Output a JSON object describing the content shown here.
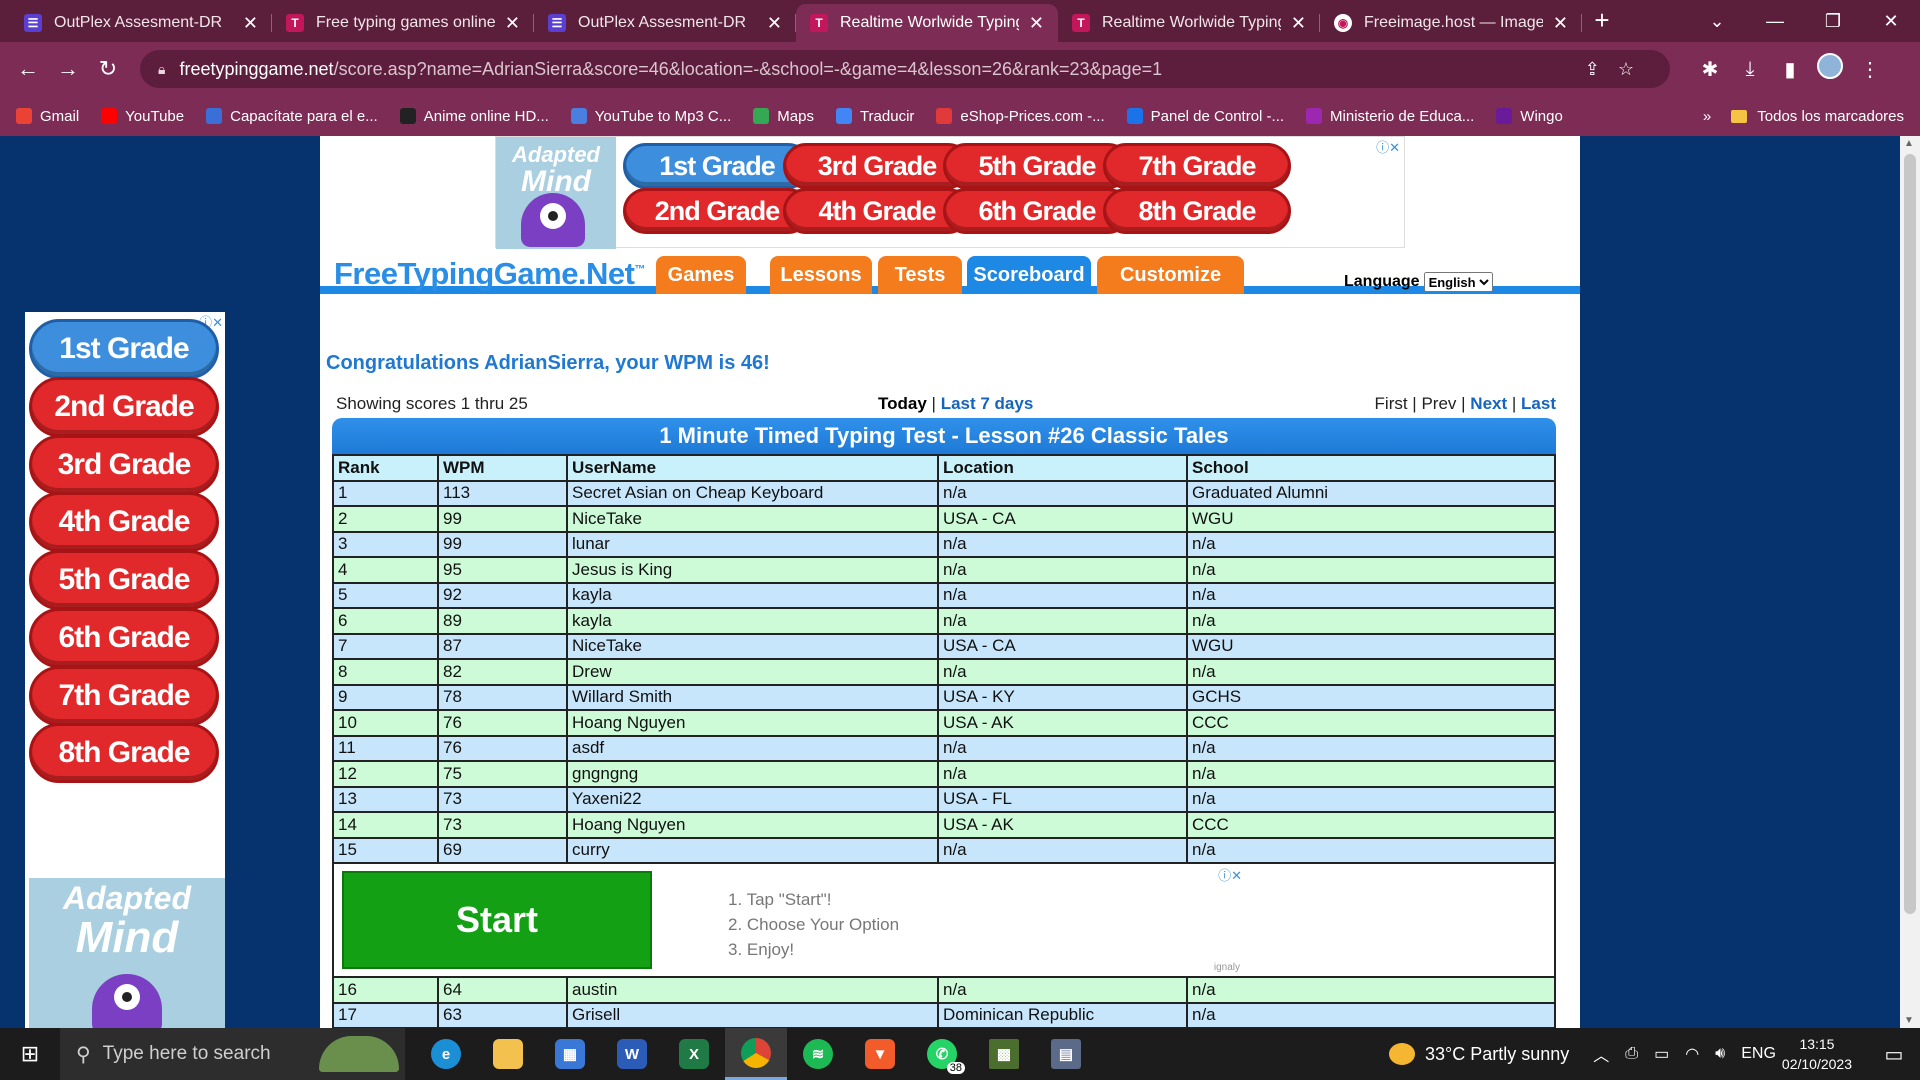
{
  "browser": {
    "tabs": [
      {
        "title": "OutPlex Assesment-DR",
        "icon": "purple"
      },
      {
        "title": "Free typing games online,",
        "icon": "pink"
      },
      {
        "title": "OutPlex Assesment-DR",
        "icon": "purple"
      },
      {
        "title": "Realtime Worlwide Typing",
        "icon": "pink",
        "active": true
      },
      {
        "title": "Realtime Worlwide Typing",
        "icon": "pink"
      },
      {
        "title": "Freeimage.host — Image H",
        "icon": "white"
      }
    ],
    "url_host": "freetypinggame.net",
    "url_rest": "/score.asp?name=AdrianSierra&score=46&location=-&school=-&game=4&lesson=26&rank=23&page=1",
    "bookmarks": [
      {
        "label": "Gmail",
        "color": "#ea4335"
      },
      {
        "label": "YouTube",
        "color": "#ff0000"
      },
      {
        "label": "Capacítate para el e...",
        "color": "#3a6fd8"
      },
      {
        "label": "Anime online HD...",
        "color": "#222222"
      },
      {
        "label": "YouTube to Mp3 C...",
        "color": "#4a7fe0"
      },
      {
        "label": "Maps",
        "color": "#34a853"
      },
      {
        "label": "Traducir",
        "color": "#4285f4"
      },
      {
        "label": "eShop-Prices.com -...",
        "color": "#e03a3a"
      },
      {
        "label": "Panel de Control -...",
        "color": "#1a73e8"
      },
      {
        "label": "Ministerio de Educa...",
        "color": "#9c27b0"
      },
      {
        "label": "Wingo",
        "color": "#6a1b9a"
      }
    ],
    "bookmarks_more": "»",
    "all_bookmarks": "Todos los marcadores"
  },
  "ads": {
    "top_grades": [
      "1st Grade",
      "3rd Grade",
      "5th Grade",
      "7th Grade",
      "2nd Grade",
      "4th Grade",
      "6th Grade",
      "8th Grade"
    ],
    "side_grades": [
      "1st Grade",
      "2nd Grade",
      "3rd Grade",
      "4th Grade",
      "5th Grade",
      "6th Grade",
      "7th Grade",
      "8th Grade"
    ],
    "brand_line1": "Adapted",
    "brand_line2": "Mind",
    "inline_start": "Start",
    "inline_steps": [
      "1. Tap \"Start\"!",
      "2. Choose Your Option",
      "3. Enjoy!"
    ],
    "inline_vendor": "ignaly"
  },
  "site": {
    "logo": "FreeTypingGame.Net",
    "logo_tm": "™",
    "nav": [
      "Games",
      "Lessons",
      "Tests",
      "Scoreboard",
      "Customize"
    ],
    "language_label": "Language",
    "language_value": "English"
  },
  "scoreboard": {
    "congrats": "Congratulations AdrianSierra, your WPM is 46!",
    "showing": "Showing scores 1 thru 25",
    "today": "Today",
    "last7": "Last 7 days",
    "first": "First",
    "prev": "Prev",
    "next": "Next",
    "last": "Last",
    "title": "1 Minute Timed Typing Test - Lesson #26 Classic Tales",
    "headers": [
      "Rank",
      "WPM",
      "UserName",
      "Location",
      "School"
    ],
    "rows": [
      [
        "1",
        "113",
        "Secret Asian on Cheap Keyboard",
        "n/a",
        "Graduated Alumni"
      ],
      [
        "2",
        "99",
        "NiceTake",
        "USA - CA",
        "WGU"
      ],
      [
        "3",
        "99",
        "lunar",
        "n/a",
        "n/a"
      ],
      [
        "4",
        "95",
        "Jesus is King",
        "n/a",
        "n/a"
      ],
      [
        "5",
        "92",
        "kayla",
        "n/a",
        "n/a"
      ],
      [
        "6",
        "89",
        "kayla",
        "n/a",
        "n/a"
      ],
      [
        "7",
        "87",
        "NiceTake",
        "USA - CA",
        "WGU"
      ],
      [
        "8",
        "82",
        "Drew",
        "n/a",
        "n/a"
      ],
      [
        "9",
        "78",
        "Willard Smith",
        "USA - KY",
        "GCHS"
      ],
      [
        "10",
        "76",
        "Hoang Nguyen",
        "USA - AK",
        "CCC"
      ],
      [
        "11",
        "76",
        "asdf",
        "n/a",
        "n/a"
      ],
      [
        "12",
        "75",
        "gngngng",
        "n/a",
        "n/a"
      ],
      [
        "13",
        "73",
        "Yaxeni22",
        "USA - FL",
        "n/a"
      ],
      [
        "14",
        "73",
        "Hoang Nguyen",
        "USA - AK",
        "CCC"
      ],
      [
        "15",
        "69",
        "curry",
        "n/a",
        "n/a"
      ],
      [
        "16",
        "64",
        "austin",
        "n/a",
        "n/a"
      ],
      [
        "17",
        "63",
        "Grisell",
        "Dominican Republic",
        "n/a"
      ]
    ]
  },
  "taskbar": {
    "search_placeholder": "Type here to search",
    "whatsapp_badge": "38",
    "weather": "33°C  Partly sunny",
    "lang": "ENG",
    "time": "13:15",
    "date": "02/10/2023"
  }
}
